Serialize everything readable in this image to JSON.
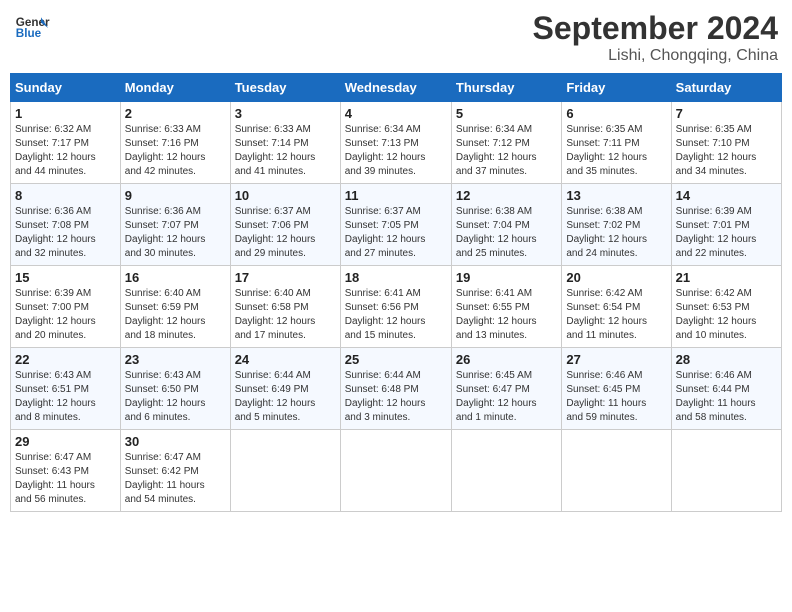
{
  "header": {
    "logo_line1": "General",
    "logo_line2": "Blue",
    "month": "September 2024",
    "location": "Lishi, Chongqing, China"
  },
  "weekdays": [
    "Sunday",
    "Monday",
    "Tuesday",
    "Wednesday",
    "Thursday",
    "Friday",
    "Saturday"
  ],
  "weeks": [
    [
      {
        "day": "1",
        "info": "Sunrise: 6:32 AM\nSunset: 7:17 PM\nDaylight: 12 hours\nand 44 minutes."
      },
      {
        "day": "2",
        "info": "Sunrise: 6:33 AM\nSunset: 7:16 PM\nDaylight: 12 hours\nand 42 minutes."
      },
      {
        "day": "3",
        "info": "Sunrise: 6:33 AM\nSunset: 7:14 PM\nDaylight: 12 hours\nand 41 minutes."
      },
      {
        "day": "4",
        "info": "Sunrise: 6:34 AM\nSunset: 7:13 PM\nDaylight: 12 hours\nand 39 minutes."
      },
      {
        "day": "5",
        "info": "Sunrise: 6:34 AM\nSunset: 7:12 PM\nDaylight: 12 hours\nand 37 minutes."
      },
      {
        "day": "6",
        "info": "Sunrise: 6:35 AM\nSunset: 7:11 PM\nDaylight: 12 hours\nand 35 minutes."
      },
      {
        "day": "7",
        "info": "Sunrise: 6:35 AM\nSunset: 7:10 PM\nDaylight: 12 hours\nand 34 minutes."
      }
    ],
    [
      {
        "day": "8",
        "info": "Sunrise: 6:36 AM\nSunset: 7:08 PM\nDaylight: 12 hours\nand 32 minutes."
      },
      {
        "day": "9",
        "info": "Sunrise: 6:36 AM\nSunset: 7:07 PM\nDaylight: 12 hours\nand 30 minutes."
      },
      {
        "day": "10",
        "info": "Sunrise: 6:37 AM\nSunset: 7:06 PM\nDaylight: 12 hours\nand 29 minutes."
      },
      {
        "day": "11",
        "info": "Sunrise: 6:37 AM\nSunset: 7:05 PM\nDaylight: 12 hours\nand 27 minutes."
      },
      {
        "day": "12",
        "info": "Sunrise: 6:38 AM\nSunset: 7:04 PM\nDaylight: 12 hours\nand 25 minutes."
      },
      {
        "day": "13",
        "info": "Sunrise: 6:38 AM\nSunset: 7:02 PM\nDaylight: 12 hours\nand 24 minutes."
      },
      {
        "day": "14",
        "info": "Sunrise: 6:39 AM\nSunset: 7:01 PM\nDaylight: 12 hours\nand 22 minutes."
      }
    ],
    [
      {
        "day": "15",
        "info": "Sunrise: 6:39 AM\nSunset: 7:00 PM\nDaylight: 12 hours\nand 20 minutes."
      },
      {
        "day": "16",
        "info": "Sunrise: 6:40 AM\nSunset: 6:59 PM\nDaylight: 12 hours\nand 18 minutes."
      },
      {
        "day": "17",
        "info": "Sunrise: 6:40 AM\nSunset: 6:58 PM\nDaylight: 12 hours\nand 17 minutes."
      },
      {
        "day": "18",
        "info": "Sunrise: 6:41 AM\nSunset: 6:56 PM\nDaylight: 12 hours\nand 15 minutes."
      },
      {
        "day": "19",
        "info": "Sunrise: 6:41 AM\nSunset: 6:55 PM\nDaylight: 12 hours\nand 13 minutes."
      },
      {
        "day": "20",
        "info": "Sunrise: 6:42 AM\nSunset: 6:54 PM\nDaylight: 12 hours\nand 11 minutes."
      },
      {
        "day": "21",
        "info": "Sunrise: 6:42 AM\nSunset: 6:53 PM\nDaylight: 12 hours\nand 10 minutes."
      }
    ],
    [
      {
        "day": "22",
        "info": "Sunrise: 6:43 AM\nSunset: 6:51 PM\nDaylight: 12 hours\nand 8 minutes."
      },
      {
        "day": "23",
        "info": "Sunrise: 6:43 AM\nSunset: 6:50 PM\nDaylight: 12 hours\nand 6 minutes."
      },
      {
        "day": "24",
        "info": "Sunrise: 6:44 AM\nSunset: 6:49 PM\nDaylight: 12 hours\nand 5 minutes."
      },
      {
        "day": "25",
        "info": "Sunrise: 6:44 AM\nSunset: 6:48 PM\nDaylight: 12 hours\nand 3 minutes."
      },
      {
        "day": "26",
        "info": "Sunrise: 6:45 AM\nSunset: 6:47 PM\nDaylight: 12 hours\nand 1 minute."
      },
      {
        "day": "27",
        "info": "Sunrise: 6:46 AM\nSunset: 6:45 PM\nDaylight: 11 hours\nand 59 minutes."
      },
      {
        "day": "28",
        "info": "Sunrise: 6:46 AM\nSunset: 6:44 PM\nDaylight: 11 hours\nand 58 minutes."
      }
    ],
    [
      {
        "day": "29",
        "info": "Sunrise: 6:47 AM\nSunset: 6:43 PM\nDaylight: 11 hours\nand 56 minutes."
      },
      {
        "day": "30",
        "info": "Sunrise: 6:47 AM\nSunset: 6:42 PM\nDaylight: 11 hours\nand 54 minutes."
      },
      {
        "day": "",
        "info": ""
      },
      {
        "day": "",
        "info": ""
      },
      {
        "day": "",
        "info": ""
      },
      {
        "day": "",
        "info": ""
      },
      {
        "day": "",
        "info": ""
      }
    ]
  ]
}
